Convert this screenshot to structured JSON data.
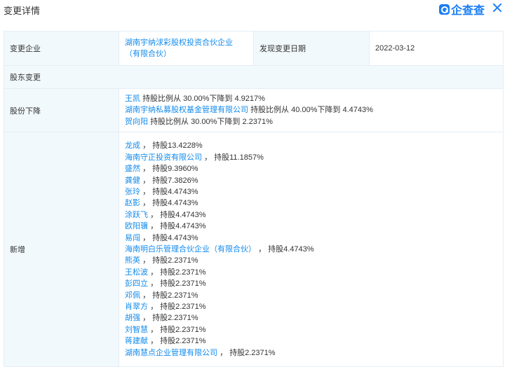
{
  "header": {
    "title": "变更详情",
    "logo_text": "企查查"
  },
  "summary": {
    "company_label": "变更企业",
    "company_name": "湖南宇纳浗彩股权投资合伙企业（有限合伙）",
    "date_label": "发现变更日期",
    "date_value": "2022-03-12"
  },
  "section_label": "股东变更",
  "decrease": {
    "label": "股份下降",
    "items": [
      {
        "name": "王凯",
        "text": "持股比例从 30.00%下降到 4.9217%"
      },
      {
        "name": "湖南宇纳私募股权基金管理有限公司",
        "text": "持股比例从 40.00%下降到 4.4743%"
      },
      {
        "name": "贺向阳",
        "text": "持股比例从 30.00%下降到 2.2371%"
      }
    ]
  },
  "added": {
    "label": "新增",
    "items": [
      {
        "name": "龙成",
        "text": "， 持股13.4228%"
      },
      {
        "name": "海南守正投资有限公司",
        "text": "， 持股11.1857%"
      },
      {
        "name": "盛然",
        "text": "， 持股9.3960%"
      },
      {
        "name": "龚健",
        "text": "， 持股7.3826%"
      },
      {
        "name": "张玲",
        "text": "， 持股4.4743%"
      },
      {
        "name": "赵影",
        "text": "， 持股4.4743%"
      },
      {
        "name": "涂跃飞",
        "text": "， 持股4.4743%"
      },
      {
        "name": "欧阳骥",
        "text": "， 持股4.4743%"
      },
      {
        "name": "易闯",
        "text": "， 持股4.4743%"
      },
      {
        "name": "海南明白乐管理合伙企业（有限合伙）",
        "text": "， 持股4.4743%"
      },
      {
        "name": "熊英",
        "text": "， 持股2.2371%"
      },
      {
        "name": "王松波",
        "text": "， 持股2.2371%"
      },
      {
        "name": "彭四立",
        "text": "， 持股2.2371%"
      },
      {
        "name": "邓佩",
        "text": "， 持股2.2371%"
      },
      {
        "name": "肖翠方",
        "text": "， 持股2.2371%"
      },
      {
        "name": "胡强",
        "text": "， 持股2.2371%"
      },
      {
        "name": "刘智慧",
        "text": "， 持股2.2371%"
      },
      {
        "name": "蒋建献",
        "text": "， 持股2.2371%"
      },
      {
        "name": "湖南慧点企业管理有限公司",
        "text": "， 持股2.2371%"
      }
    ]
  }
}
